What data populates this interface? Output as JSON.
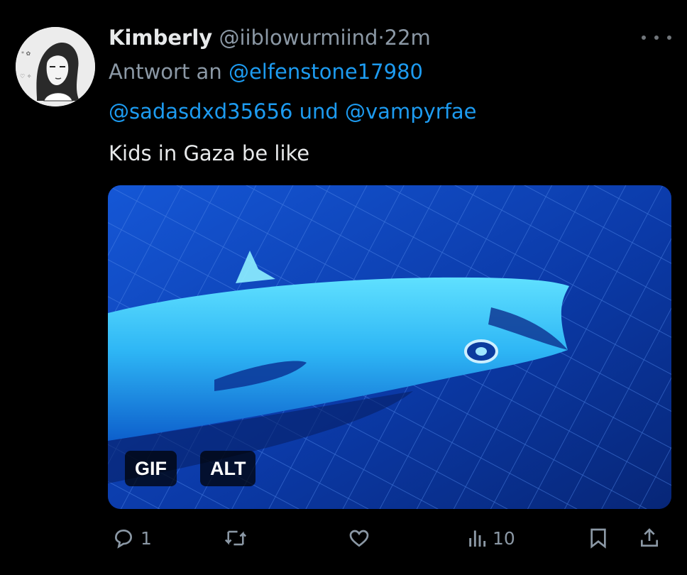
{
  "post": {
    "author": {
      "display_name": "Kimberly",
      "handle": "@iiblowurmiind",
      "separator": "·",
      "time": "22m",
      "avatar": "avatar-icon"
    },
    "reply": {
      "label": "Antwort an",
      "mention_1": "@elfenstone17980",
      "mention_2": "@sadasdxd35656",
      "conjunction": "und",
      "mention_3": "@vampyrfae"
    },
    "text": "Kids in Gaza be like",
    "media": {
      "type": "gif",
      "badge_gif": "GIF",
      "badge_alt": "ALT",
      "description_icon": "fish-image"
    },
    "actions": {
      "reply_count": "1",
      "views_count": "10",
      "icons": [
        "reply-icon",
        "repost-icon",
        "like-icon",
        "views-icon",
        "bookmark-icon",
        "share-icon"
      ]
    }
  },
  "colors": {
    "background": "#000000",
    "text_primary": "#e7e9ea",
    "text_secondary": "#8b98a5",
    "link": "#1d9bf0",
    "media_blue": "#0a3fb8"
  }
}
